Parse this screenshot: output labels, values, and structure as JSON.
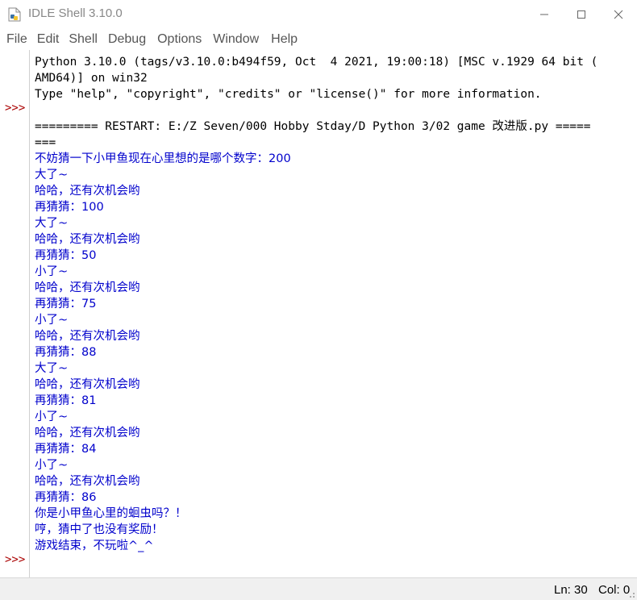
{
  "window": {
    "title": "IDLE Shell 3.10.0",
    "controls": {
      "minimize": "—",
      "maximize": "☐",
      "close": "✕"
    }
  },
  "menu": [
    "File",
    "Edit",
    "Shell",
    "Debug",
    "Options",
    "Window",
    "Help"
  ],
  "sidebar": {
    "prompt": ">>>"
  },
  "shell": {
    "lines": [
      {
        "text": "Python 3.10.0 (tags/v3.10.0:b494f59, Oct  4 2021, 19:00:18) [MSC v.1929 64 bit (",
        "style": "black"
      },
      {
        "text": "AMD64)] on win32",
        "style": "black"
      },
      {
        "text": "Type \"help\", \"copyright\", \"credits\" or \"license()\" for more information.",
        "style": "black"
      },
      {
        "text": "",
        "style": "black"
      },
      {
        "text": "========= RESTART: E:/Z Seven/000 Hobby Stday/D Python 3/02 game 改进版.py =====",
        "style": "black"
      },
      {
        "text": "===",
        "style": "black"
      },
      {
        "text": "不妨猜一下小甲鱼现在心里想的是哪个数字：200",
        "style": "blue"
      },
      {
        "text": "大了~",
        "style": "blue"
      },
      {
        "text": "哈哈，还有次机会哟",
        "style": "blue"
      },
      {
        "text": "再猜猜：100",
        "style": "blue"
      },
      {
        "text": "大了~",
        "style": "blue"
      },
      {
        "text": "哈哈，还有次机会哟",
        "style": "blue"
      },
      {
        "text": "再猜猜：50",
        "style": "blue"
      },
      {
        "text": "小了~",
        "style": "blue"
      },
      {
        "text": "哈哈，还有次机会哟",
        "style": "blue"
      },
      {
        "text": "再猜猜：75",
        "style": "blue"
      },
      {
        "text": "小了~",
        "style": "blue"
      },
      {
        "text": "哈哈，还有次机会哟",
        "style": "blue"
      },
      {
        "text": "再猜猜：88",
        "style": "blue"
      },
      {
        "text": "大了~",
        "style": "blue"
      },
      {
        "text": "哈哈，还有次机会哟",
        "style": "blue"
      },
      {
        "text": "再猜猜：81",
        "style": "blue"
      },
      {
        "text": "小了~",
        "style": "blue"
      },
      {
        "text": "哈哈，还有次机会哟",
        "style": "blue"
      },
      {
        "text": "再猜猜：84",
        "style": "blue"
      },
      {
        "text": "小了~",
        "style": "blue"
      },
      {
        "text": "哈哈，还有次机会哟",
        "style": "blue"
      },
      {
        "text": "再猜猜：86",
        "style": "blue"
      },
      {
        "text": "你是小甲鱼心里的蛔虫吗？！",
        "style": "blue"
      },
      {
        "text": "哼，猜中了也没有奖励！",
        "style": "blue"
      },
      {
        "text": "游戏结束，不玩啦^_^",
        "style": "blue"
      }
    ]
  },
  "status": {
    "line": "Ln: 30",
    "col": "Col: 0"
  },
  "colors": {
    "prompt": "#aa0000",
    "output": "#0000cc",
    "text": "#000000"
  }
}
